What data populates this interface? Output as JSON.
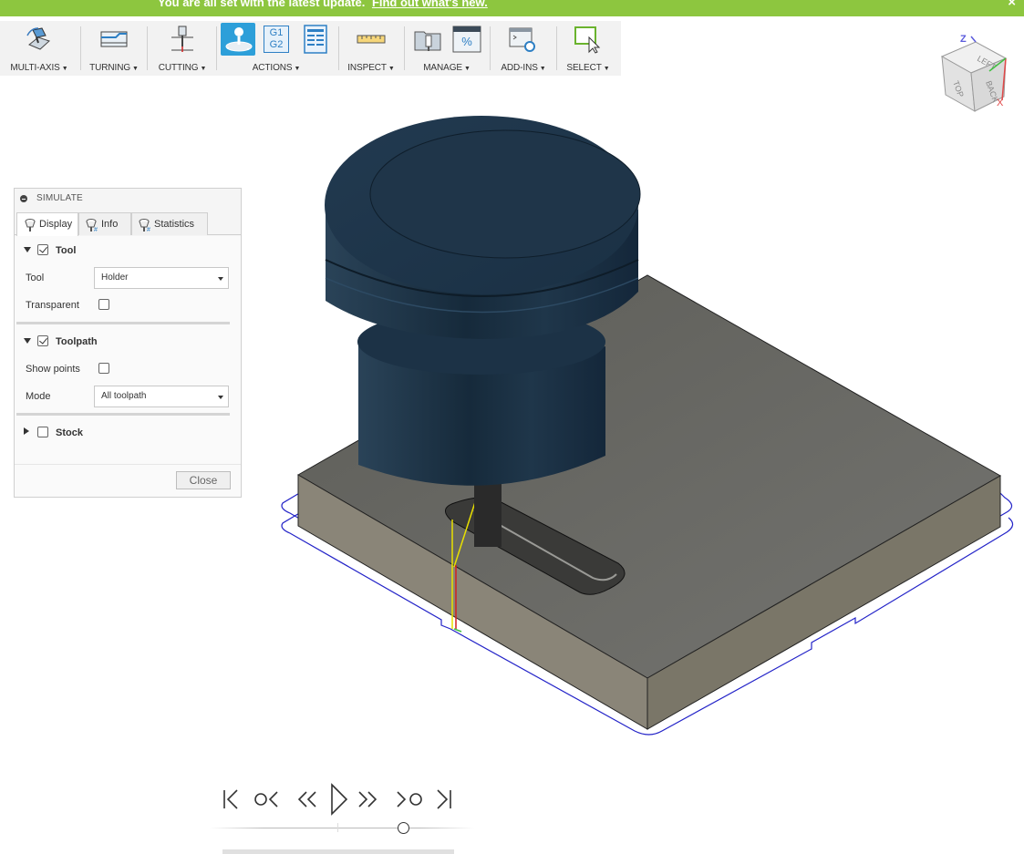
{
  "banner": {
    "message": "You are all set with the latest update.",
    "link": "Find out what's new.",
    "close": "×"
  },
  "toolbar": {
    "groups": [
      {
        "label": "MULTI-AXIS",
        "icon": "multi-axis-icon"
      },
      {
        "label": "TURNING",
        "icon": "turning-icon"
      },
      {
        "label": "CUTTING",
        "icon": "cutting-icon"
      },
      {
        "label": "ACTIONS",
        "icon": "actions-icon"
      },
      {
        "label": "INSPECT",
        "icon": "inspect-icon"
      },
      {
        "label": "MANAGE",
        "icon": "manage-icon"
      },
      {
        "label": "ADD-INS",
        "icon": "add-ins-icon"
      },
      {
        "label": "SELECT",
        "icon": "select-icon"
      }
    ],
    "gcode_label_top": "G1",
    "gcode_label_bottom": "G2",
    "percent_label": "%",
    "caret": "▼"
  },
  "viewcube": {
    "faces": [
      "LEFT",
      "TOP",
      "BACK"
    ],
    "axis_z": "Z",
    "axis_x": "X"
  },
  "simulate": {
    "title": "SIMULATE",
    "tabs": [
      {
        "label": "Display",
        "active": true
      },
      {
        "label": "Info",
        "active": false
      },
      {
        "label": "Statistics",
        "active": false
      }
    ],
    "sections": {
      "tool": {
        "label": "Tool",
        "checked": true,
        "expanded": true
      },
      "toolpath": {
        "label": "Toolpath",
        "checked": true,
        "expanded": true
      },
      "stock": {
        "label": "Stock",
        "checked": false,
        "expanded": false
      }
    },
    "fields": {
      "tool_label": "Tool",
      "tool_value": "Holder",
      "transparent_label": "Transparent",
      "transparent_checked": false,
      "show_points_label": "Show points",
      "show_points_checked": false,
      "mode_label": "Mode",
      "mode_value": "All toolpath"
    },
    "close_label": "Close"
  },
  "colors": {
    "banner": "#8dc63f",
    "toolbar_bg": "#f2f2f2",
    "active_icon": "#2d9fd9",
    "stock_top": "#6b6b66",
    "stock_side": "#8a8578",
    "holder": "#1e3448",
    "toolpath_blue": "#2323c8",
    "toolpath_yellow": "#e8e000",
    "toolpath_red": "#d02020"
  },
  "playback": {
    "buttons": [
      "go-to-start",
      "previous-operation",
      "step-back",
      "play",
      "step-forward",
      "next-operation",
      "go-to-end"
    ]
  }
}
